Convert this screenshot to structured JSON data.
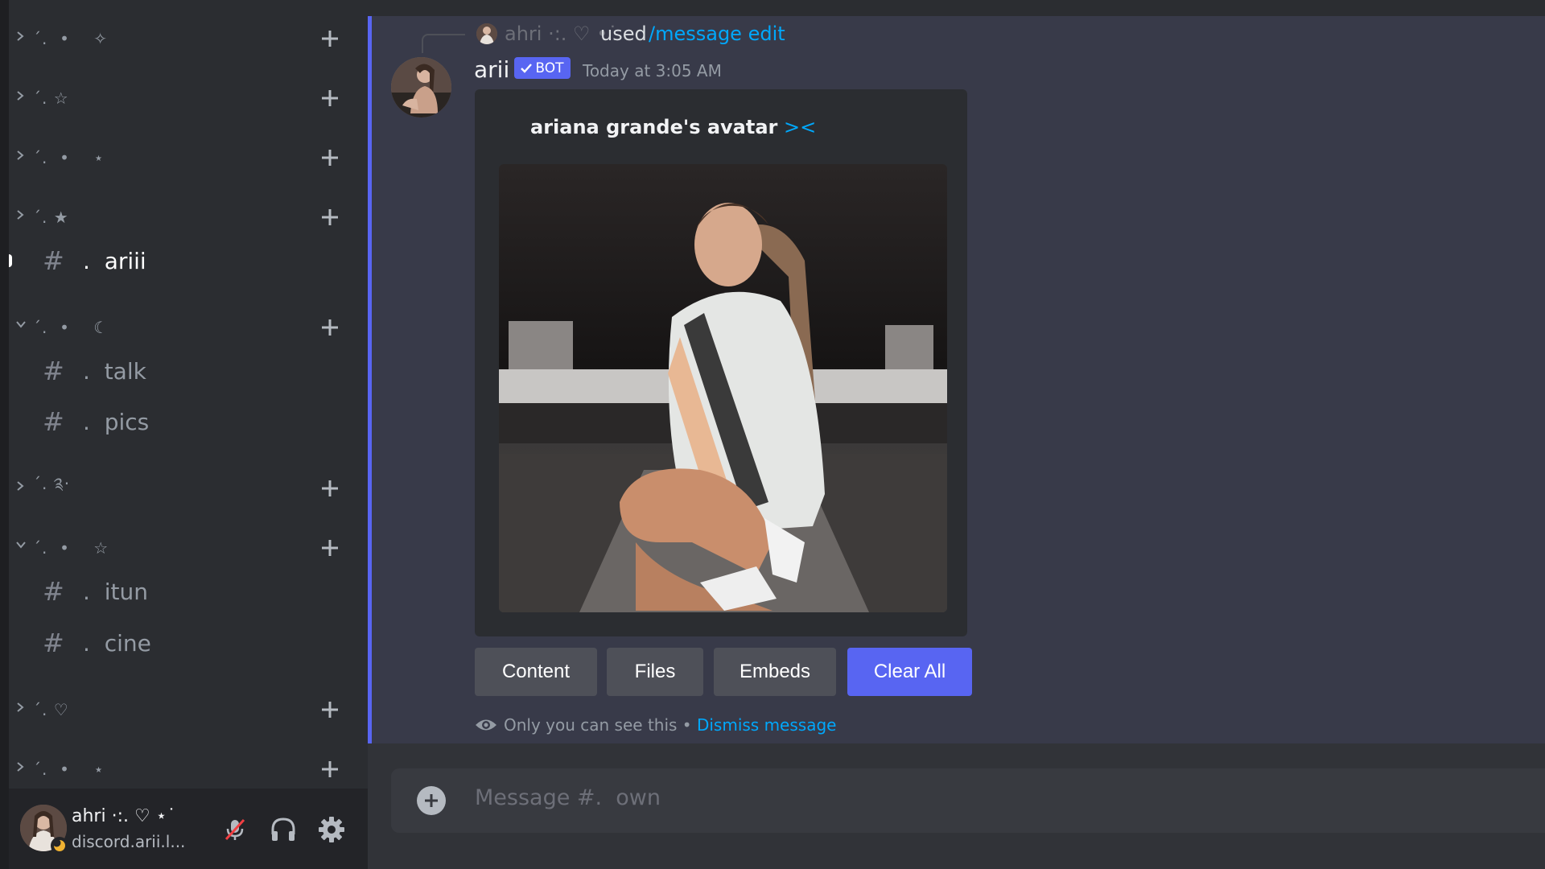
{
  "sidebar": {
    "categories": [
      {
        "name": "ˊ.  •    ✧",
        "expanded": false
      },
      {
        "name": "ˊ. ☆",
        "expanded": false
      },
      {
        "name": "ˊ.  •    ⋆",
        "expanded": false
      },
      {
        "name": "ˊ. ★",
        "expanded": false
      },
      {
        "name": "ˊ.  •    ☾",
        "expanded": true
      },
      {
        "name": "ˊ. ༉‧",
        "expanded": false
      },
      {
        "name": "ˊ.  •    ☆",
        "expanded": true
      },
      {
        "name": "ˊ. ♡",
        "expanded": false
      },
      {
        "name": "ˊ.  •    ⋆",
        "expanded": false
      }
    ],
    "channels": [
      {
        "hash": "#",
        "name": ".  ariii",
        "active": true
      },
      {
        "hash": "#",
        "name": ".  talk",
        "active": false
      },
      {
        "hash": "#",
        "name": ".  pics",
        "active": false
      },
      {
        "hash": "#",
        "name": ".  itun",
        "active": false
      },
      {
        "hash": "#",
        "name": ".  cine",
        "active": false
      }
    ]
  },
  "user_panel": {
    "name": "ahri ·:. ♡ ⋆˙",
    "status": "discord.arii.l...",
    "icons": [
      "mute-icon",
      "headphones-icon",
      "settings-gear-icon"
    ]
  },
  "message": {
    "reply": {
      "user": "ahri ·:. ♡ •˙",
      "used": "used",
      "command": "/message edit"
    },
    "author": "arii",
    "bot_tag": "BOT",
    "timestamp": "Today at 3:05 AM",
    "embed": {
      "author_text": "ariana grande's avatar",
      "author_suffix": " ><"
    },
    "buttons": {
      "content": "Content",
      "files": "Files",
      "embeds": "Embeds",
      "clear_all": "Clear All"
    },
    "ephemeral": {
      "note": "Only you can see this • ",
      "dismiss": "Dismiss message"
    }
  },
  "composer": {
    "placeholder": "Message #.  own"
  },
  "colors": {
    "blurple": "#5865f2",
    "link": "#00a8fc",
    "sidebar_bg": "#2b2d31",
    "chat_bg": "#313338",
    "ephemeral_bg": "#383a49"
  }
}
